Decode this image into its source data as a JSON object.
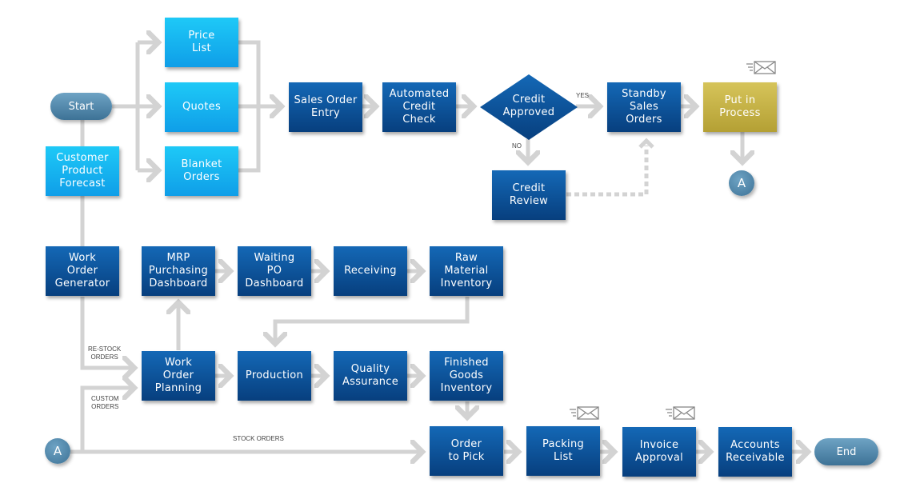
{
  "nodes": {
    "start": "Start",
    "price_list": "Price\nList",
    "quotes": "Quotes",
    "blanket_orders": "Blanket\nOrders",
    "customer_product_forecast": "Customer\nProduct\nForecast",
    "sales_order_entry": "Sales Order\nEntry",
    "automated_credit_check": "Automated\nCredit\nCheck",
    "credit_approved": "Credit\nApproved",
    "standby_sales_orders": "Standby\nSales\nOrders",
    "put_in_process": "Put in\nProcess",
    "credit_review": "Credit\nReview",
    "connector_a_top": "A",
    "work_order_generator": "Work\nOrder\nGenerator",
    "mrp_purchasing_dashboard": "MRP\nPurchasing\nDashboard",
    "waiting_po_dashboard": "Waiting\nPO\nDashboard",
    "receiving": "Receiving",
    "raw_material_inventory": "Raw\nMaterial\nInventory",
    "work_order_planning": "Work\nOrder\nPlanning",
    "production": "Production",
    "quality_assurance": "Quality\nAssurance",
    "finished_goods_inventory": "Finished\nGoods\nInventory",
    "connector_a_bottom": "A",
    "order_to_pick": "Order\nto Pick",
    "packing_list": "Packing\nList",
    "invoice_approval": "Invoice\nApproval",
    "accounts_receivable": "Accounts\nReceivable",
    "end": "End"
  },
  "labels": {
    "yes": "YES",
    "no": "NO",
    "restock_orders": "RE-STOCK\nORDERS",
    "custom_orders": "CUSTOM\nORDERS",
    "stock_orders": "STOCK ORDERS"
  },
  "icons": {
    "email": "email-send-icon"
  },
  "colors": {
    "process_dark": "#0b52a0",
    "process_light": "#17b4f0",
    "highlight_gold": "#c6b245",
    "terminator": "#5589ad",
    "connector_line": "#d3d3d3"
  }
}
